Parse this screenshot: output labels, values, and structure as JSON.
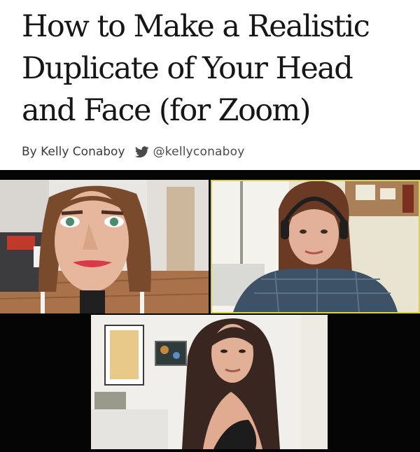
{
  "article": {
    "title_lines": [
      "How to Make a Realistic",
      "Duplicate of Your Head",
      "and Face (for Zoom)"
    ],
    "byline": {
      "author": "By Kelly Conaboy",
      "icon": "twitter-bird-icon",
      "handle": "@kellyconaboy"
    }
  },
  "zoom_call": {
    "participants": [
      {
        "id": "paper-mache-head",
        "active_speaker": false
      },
      {
        "id": "woman-with-headphones",
        "active_speaker": true
      },
      {
        "id": "woman-dark-hair",
        "active_speaker": false
      }
    ],
    "colors": {
      "background": "#050505",
      "active_speaker_border": "#d8d24a"
    }
  }
}
